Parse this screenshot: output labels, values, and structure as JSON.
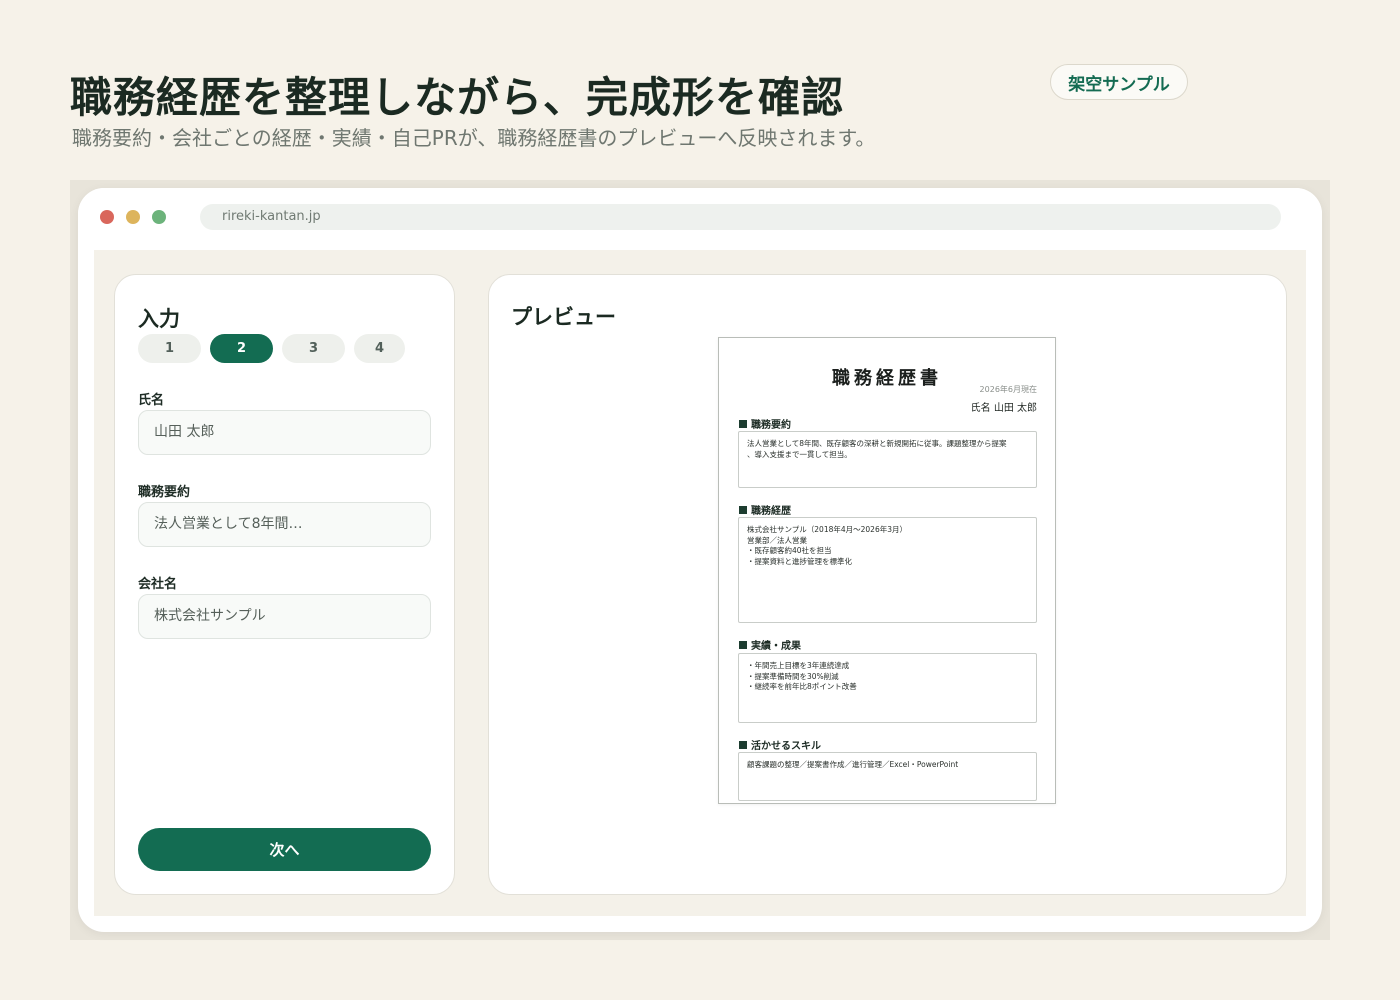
{
  "hero": {
    "title": "職務経歴を整理しながら、完成形を確認",
    "subtitle": "職務要約・会社ごとの経歴・実績・自己PRが、職務経歴書のプレビューへ反映されます。",
    "badge": "架空サンプル"
  },
  "browser": {
    "url": "rireki-kantan.jp"
  },
  "input_panel": {
    "title": "入力",
    "steps": [
      {
        "label": "1",
        "active": false
      },
      {
        "label": "2",
        "active": true
      },
      {
        "label": "3",
        "active": false
      },
      {
        "label": "4",
        "active": false
      }
    ],
    "fields": [
      {
        "label": "氏名",
        "value": "山田 太郎"
      },
      {
        "label": "職務要約",
        "value": "法人営業として8年間…"
      },
      {
        "label": "会社名",
        "value": "株式会社サンプル"
      }
    ],
    "next_label": "次へ"
  },
  "preview_panel": {
    "title": "プレビュー",
    "document": {
      "title": "職務経歴書",
      "date": "2026年6月現在",
      "name": "氏名 山田 太郎",
      "sections": [
        {
          "heading": "職務要約",
          "lines": [
            "法人営業として8年間、既存顧客の深耕と新規開拓に従事。課題整理から提案",
            "、導入支援まで一貫して担当。"
          ]
        },
        {
          "heading": "職務経歴",
          "lines": [
            "株式会社サンプル（2018年4月〜2026年3月）",
            "営業部／法人営業",
            "・既存顧客約40社を担当",
            "・提案資料と進捗管理を標準化"
          ]
        },
        {
          "heading": "実績・成果",
          "lines": [
            "・年間売上目標を3年連続達成",
            "・提案準備時間を30%削減",
            "・継続率を前年比8ポイント改善"
          ]
        },
        {
          "heading": "活かせるスキル",
          "lines": [
            "顧客課題の整理／提案書作成／進行管理／Excel・PowerPoint"
          ]
        }
      ]
    }
  }
}
